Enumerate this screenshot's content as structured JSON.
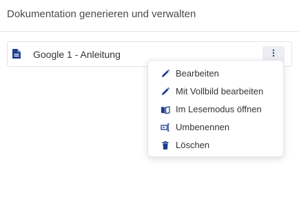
{
  "header": {
    "title": "Dokumentation generieren und verwalten"
  },
  "document": {
    "title": "Google 1 - Anleitung",
    "icon": "document-icon"
  },
  "colors": {
    "accent": "#1f3f8f",
    "menu_border": "#e2e5ea",
    "kebab_bg": "#eceef2"
  },
  "menu": {
    "items": [
      {
        "label": "Bearbeiten",
        "icon": "pencil-icon"
      },
      {
        "label": "Mit Vollbild bearbeiten",
        "icon": "pencil-icon"
      },
      {
        "label": "Im Lesemodus öffnen",
        "icon": "book-open-icon"
      },
      {
        "label": "Umbenennen",
        "icon": "rename-icon"
      },
      {
        "label": "Löschen",
        "icon": "trash-icon"
      }
    ]
  }
}
